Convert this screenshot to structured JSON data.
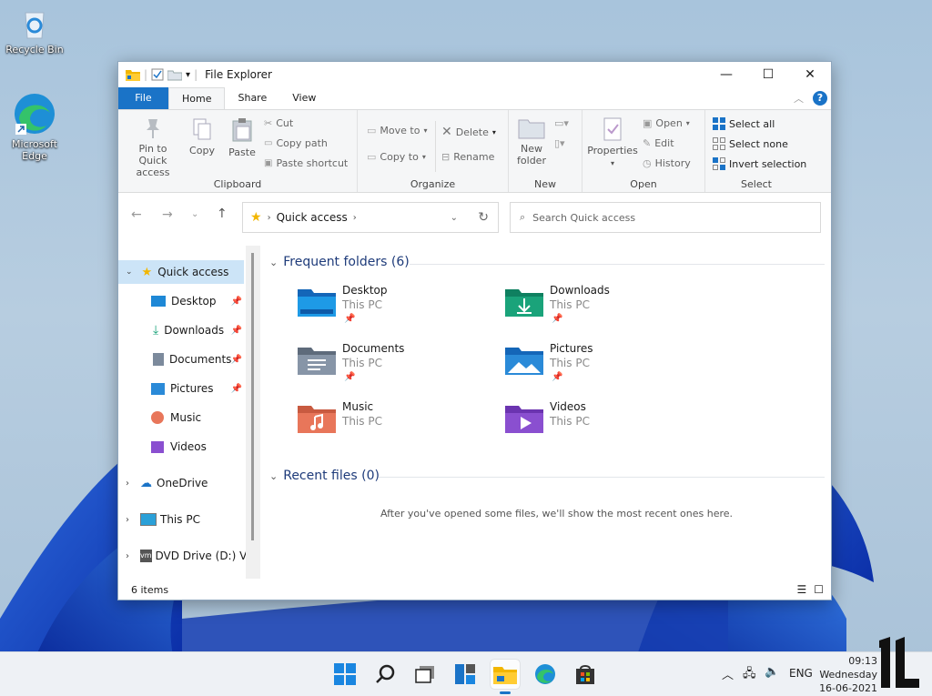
{
  "desktop": {
    "icons": [
      {
        "label": "Recycle Bin"
      },
      {
        "label": "Microsoft Edge"
      }
    ]
  },
  "window": {
    "title": "File Explorer",
    "controls": {
      "minimize": "—",
      "maximize": "☐",
      "close": "✕"
    },
    "tabs": [
      "File",
      "Home",
      "Share",
      "View"
    ],
    "active_tab": "Home",
    "help": "?"
  },
  "ribbon": {
    "clipboard": {
      "label": "Clipboard",
      "pin_to_quick_access": "Pin to Quick access",
      "pin_line1": "Pin to Quick",
      "pin_line2": "access",
      "copy": "Copy",
      "paste": "Paste",
      "cut": "Cut",
      "copy_path": "Copy path",
      "paste_shortcut": "Paste shortcut"
    },
    "organize": {
      "label": "Organize",
      "move_to": "Move to",
      "copy_to": "Copy to",
      "delete": "Delete",
      "rename": "Rename"
    },
    "new": {
      "label": "New",
      "new_folder_line1": "New",
      "new_folder_line2": "folder"
    },
    "open": {
      "label": "Open",
      "properties": "Properties",
      "open": "Open",
      "edit": "Edit",
      "history": "History"
    },
    "select": {
      "label": "Select",
      "select_all": "Select all",
      "select_none": "Select none",
      "invert_selection": "Invert selection"
    }
  },
  "address": {
    "path": "Quick access",
    "search_placeholder": "Search Quick access"
  },
  "nav": {
    "quick_access": "Quick access",
    "pinned": [
      "Desktop",
      "Downloads",
      "Documents",
      "Pictures"
    ],
    "other": [
      "Music",
      "Videos"
    ],
    "onedrive": "OneDrive",
    "this_pc": "This PC",
    "dvd": "DVD Drive (D:) VM"
  },
  "content": {
    "frequent_header": "Frequent folders (6)",
    "folders": [
      {
        "name": "Desktop",
        "location": "This PC",
        "pinned": true,
        "color": "#1e88d6"
      },
      {
        "name": "Downloads",
        "location": "This PC",
        "pinned": true,
        "color": "#1aa37a"
      },
      {
        "name": "Documents",
        "location": "This PC",
        "pinned": true,
        "color": "#7c8a9c"
      },
      {
        "name": "Pictures",
        "location": "This PC",
        "pinned": true,
        "color": "#2a8ad8"
      },
      {
        "name": "Music",
        "location": "This PC",
        "pinned": false,
        "color": "#e8765a"
      },
      {
        "name": "Videos",
        "location": "This PC",
        "pinned": false,
        "color": "#8a4fd0"
      }
    ],
    "recent_header": "Recent files (0)",
    "recent_empty": "After you've opened some files, we'll show the most recent ones here."
  },
  "status": {
    "items": "6 items"
  },
  "taskbar": {
    "tray_lang": "ENG",
    "time": "09:13",
    "day": "Wednesday",
    "date": "16-06-2021"
  },
  "colors": {
    "accent": "#1a73c7",
    "selection": "#cce4f7",
    "section_header": "#1e3b7a"
  }
}
